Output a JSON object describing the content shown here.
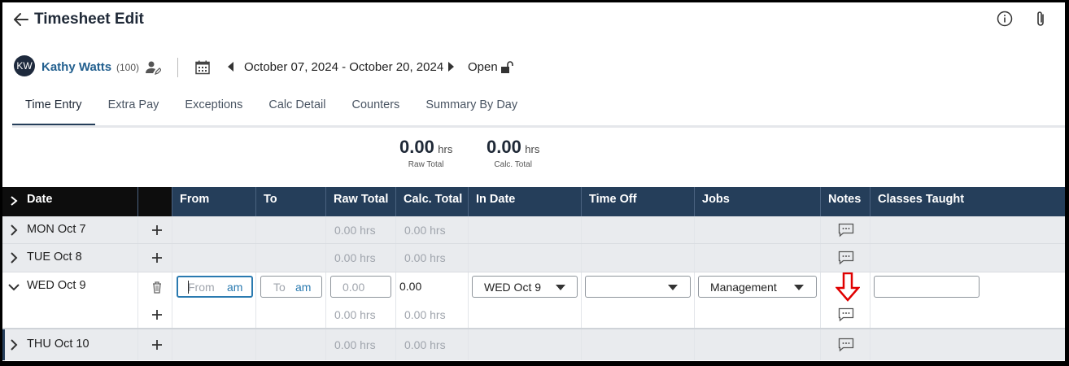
{
  "header": {
    "title": "Timesheet Edit",
    "icons": {
      "back": "arrow-left-icon",
      "info": "info-circle-icon",
      "attach": "paperclip-icon"
    }
  },
  "employee": {
    "initials": "KW",
    "name": "Kathy Watts",
    "id": "(100)",
    "date_range": "October 07, 2024 - October 20, 2024",
    "status": "Open"
  },
  "tabs": [
    {
      "label": "Time Entry",
      "active": true
    },
    {
      "label": "Extra Pay"
    },
    {
      "label": "Exceptions"
    },
    {
      "label": "Calc Detail"
    },
    {
      "label": "Counters"
    },
    {
      "label": "Summary By Day"
    }
  ],
  "totals": {
    "raw": {
      "value": "0.00",
      "unit": "hrs",
      "label": "Raw Total"
    },
    "calc": {
      "value": "0.00",
      "unit": "hrs",
      "label": "Calc. Total"
    }
  },
  "table": {
    "columns": [
      "Date",
      "From",
      "To",
      "Raw Total",
      "Calc. Total",
      "In Date",
      "Time Off",
      "Jobs",
      "Notes",
      "Classes Taught"
    ],
    "rows": [
      {
        "day": "MON Oct 7",
        "raw": "0.00 hrs",
        "calc": "0.00 hrs"
      },
      {
        "day": "TUE Oct 8",
        "raw": "0.00 hrs",
        "calc": "0.00 hrs"
      },
      {
        "day": "WED Oct 9"
      },
      {
        "day": "THU Oct 10",
        "raw": "0.00 hrs",
        "calc": "0.00 hrs"
      }
    ],
    "edit_row": {
      "from_placeholder": "From",
      "from_ampm": "am",
      "to_placeholder": "To",
      "to_ampm": "am",
      "raw_placeholder": "0.00",
      "calc_value": "0.00",
      "in_date": "WED Oct 9",
      "time_off": "",
      "job": "Management",
      "classes_taught": ""
    },
    "sub_row": {
      "raw": "0.00 hrs",
      "calc": "0.00 hrs"
    }
  },
  "colors": {
    "header_bg": "#253e5a",
    "date_header_bg": "#0d0d0d",
    "link": "#23608f",
    "focus": "#2a7ab0",
    "annotation_arrow": "#e00000"
  }
}
